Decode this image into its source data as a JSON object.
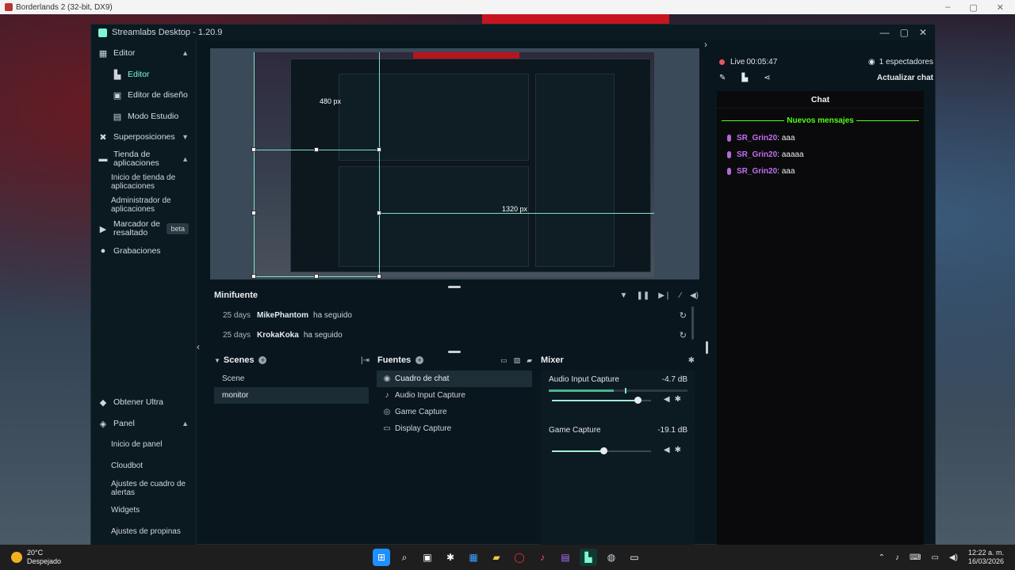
{
  "game_window": {
    "title": "Borderlands 2 (32-bit, DX9)",
    "controls": [
      "–",
      "▢",
      "✕"
    ]
  },
  "app": {
    "title": "Streamlabs Desktop - 1.20.9",
    "window_controls": [
      "—",
      "▢",
      "✕"
    ]
  },
  "sidebar": {
    "editor_group": "Editor",
    "editor": "Editor",
    "layout_editor": "Editor de diseño",
    "studio_mode": "Modo Estudio",
    "overlays": "Superposiciones",
    "app_store": "Tienda de aplicaciones",
    "app_store_home": "Inicio de tienda de aplicaciones",
    "app_manager": "Administrador de aplicaciones",
    "highlighter": "Marcador de resaltado",
    "beta": "beta",
    "recordings": "Grabaciones",
    "get_ultra": "Obtener Ultra",
    "dashboard": "Panel",
    "dashboard_home": "Inicio de panel",
    "cloudbot": "Cloudbot",
    "alertbox_settings": "Ajustes de cuadro de alertas",
    "widgets": "Widgets",
    "tip_settings": "Ajustes de propinas"
  },
  "preview": {
    "dim_width": "480 px",
    "dim_height": "1320 px"
  },
  "minifeed": {
    "title": "Minifuente",
    "events": [
      {
        "age": "25 days",
        "name": "MikePhantom",
        "action": "ha seguido"
      },
      {
        "age": "25 days",
        "name": "KrokaKoka",
        "action": "ha seguido"
      }
    ]
  },
  "scenes": {
    "title": "Scenes",
    "items": [
      "Scene",
      "monitor"
    ]
  },
  "sources": {
    "title": "Fuentes",
    "items": [
      {
        "label": "Cuadro de chat",
        "icon": "chat-bubble-icon"
      },
      {
        "label": "Audio Input Capture",
        "icon": "microphone-icon"
      },
      {
        "label": "Game Capture",
        "icon": "gamepad-icon"
      },
      {
        "label": "Display Capture",
        "icon": "monitor-icon"
      }
    ]
  },
  "mixer": {
    "title": "Mixer",
    "channels": [
      {
        "name": "Audio Input Capture",
        "db": "-4.7 dB",
        "level_pct": 47,
        "volume_pct": 85
      },
      {
        "name": "Game Capture",
        "db": "-19.1 dB",
        "level_pct": 0,
        "volume_pct": 52
      }
    ]
  },
  "stream": {
    "live_label": "Live",
    "live_time": "00:05:47",
    "viewers": "1 espectadores",
    "refresh_chat": "Actualizar chat"
  },
  "chat": {
    "title": "Chat",
    "new_messages": "Nuevos mensajes",
    "messages": [
      {
        "user": "SR_Grin20",
        "text": ": aaa"
      },
      {
        "user": "SR_Grin20",
        "text": ": aaaaa"
      },
      {
        "user": "SR_Grin20",
        "text": ": aaa"
      }
    ]
  },
  "taskbar": {
    "temp": "20°C",
    "weather": "Despejado",
    "time": "12:22 a. m.",
    "date": "16/03/2026"
  },
  "colors": {
    "accent": "#80f5d2",
    "live_red": "#e35a5a",
    "chat_green": "#53fc18",
    "chat_user": "#c06ff0"
  }
}
